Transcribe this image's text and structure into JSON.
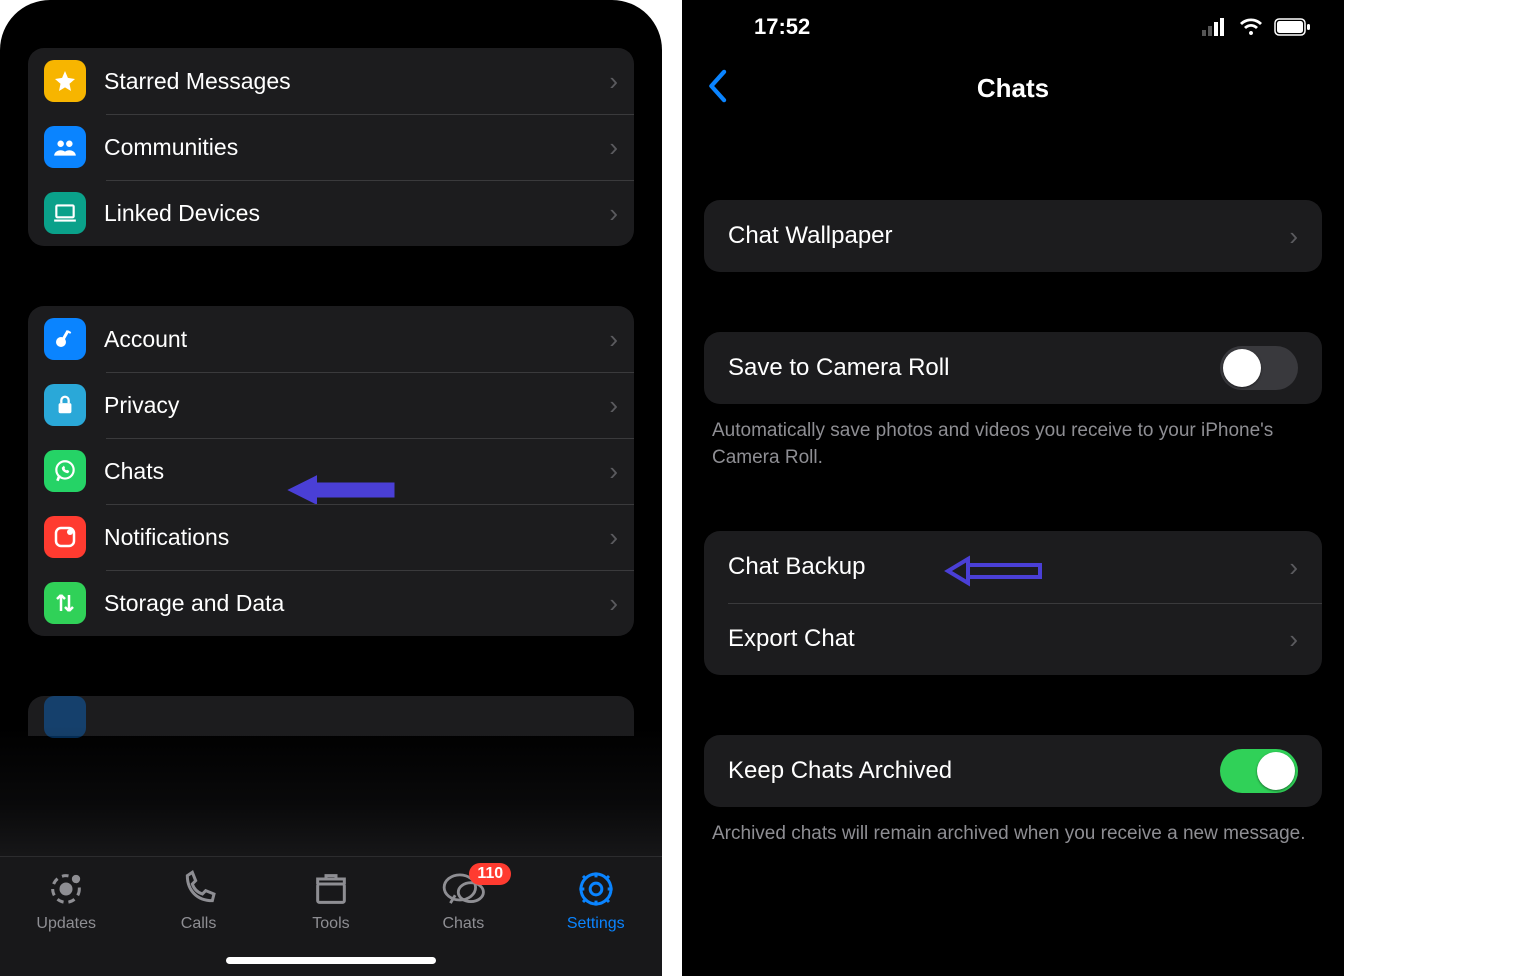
{
  "left": {
    "group1": [
      {
        "label": "Starred Messages",
        "icon": "star-icon",
        "color": "#f7b500"
      },
      {
        "label": "Communities",
        "icon": "communities-icon",
        "color": "#0a84ff"
      },
      {
        "label": "Linked Devices",
        "icon": "laptop-icon",
        "color": "#0aa18a"
      }
    ],
    "group2": [
      {
        "label": "Account",
        "icon": "key-icon",
        "color": "#0a84ff"
      },
      {
        "label": "Privacy",
        "icon": "lock-icon",
        "color": "#2aa8d8"
      },
      {
        "label": "Chats",
        "icon": "whatsapp-icon",
        "color": "#25d366",
        "annotated": true
      },
      {
        "label": "Notifications",
        "icon": "bell-icon",
        "color": "#ff3b30"
      },
      {
        "label": "Storage and Data",
        "icon": "arrows-icon",
        "color": "#30d158"
      }
    ],
    "tabs": [
      {
        "label": "Updates",
        "icon": "updates-icon"
      },
      {
        "label": "Calls",
        "icon": "calls-icon"
      },
      {
        "label": "Tools",
        "icon": "tools-icon"
      },
      {
        "label": "Chats",
        "icon": "chats-icon",
        "badge": "110"
      },
      {
        "label": "Settings",
        "icon": "settings-gear-icon",
        "active": true
      }
    ]
  },
  "right": {
    "status": {
      "time": "17:52"
    },
    "nav_title": "Chats",
    "s1": {
      "wallpaper": "Chat Wallpaper"
    },
    "s2": {
      "save_label": "Save to Camera Roll",
      "save_on": false,
      "note": "Automatically save photos and videos you receive to your iPhone's Camera Roll."
    },
    "s3": {
      "backup": "Chat Backup",
      "export": "Export Chat"
    },
    "s4": {
      "keep_label": "Keep Chats Archived",
      "keep_on": true,
      "note": "Archived chats will remain archived when you receive a new message."
    }
  }
}
